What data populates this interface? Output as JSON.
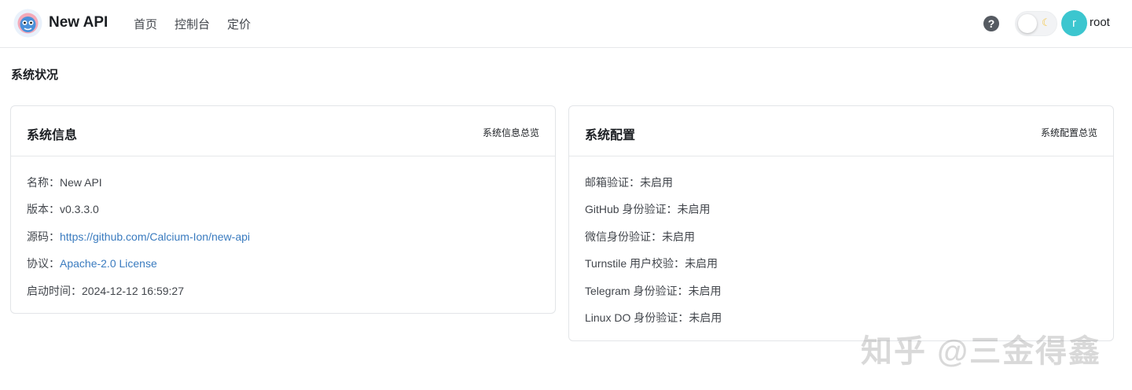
{
  "header": {
    "brand": "New API",
    "nav": [
      "首页",
      "控制台",
      "定价"
    ],
    "help_icon": "?",
    "theme_toggle_icon": "moon-icon",
    "avatar_letter": "r",
    "username": "root"
  },
  "page_title": "系统状况",
  "system_info": {
    "title": "系统信息",
    "extra": "系统信息总览",
    "rows": [
      {
        "label": "名称：",
        "value": "New API",
        "is_link": false
      },
      {
        "label": "版本：",
        "value": "v0.3.3.0",
        "is_link": false
      },
      {
        "label": "源码：",
        "value": "https://github.com/Calcium-Ion/new-api",
        "is_link": true
      },
      {
        "label": "协议：",
        "value": "Apache-2.0 License",
        "is_link": true
      },
      {
        "label": "启动时间：",
        "value": "2024-12-12 16:59:27",
        "is_link": false
      }
    ]
  },
  "system_config": {
    "title": "系统配置",
    "extra": "系统配置总览",
    "rows": [
      {
        "label": "邮箱验证：",
        "value": "未启用"
      },
      {
        "label": "GitHub 身份验证：",
        "value": "未启用"
      },
      {
        "label": "微信身份验证：",
        "value": "未启用"
      },
      {
        "label": "Turnstile 用户校验：",
        "value": "未启用"
      },
      {
        "label": "Telegram 身份验证：",
        "value": "未启用"
      },
      {
        "label": "Linux DO 身份验证：",
        "value": "未启用"
      }
    ]
  },
  "watermark": "知乎 @三金得鑫",
  "colors": {
    "link": "#3a7bbf",
    "avatar": "#3cc6cf"
  }
}
